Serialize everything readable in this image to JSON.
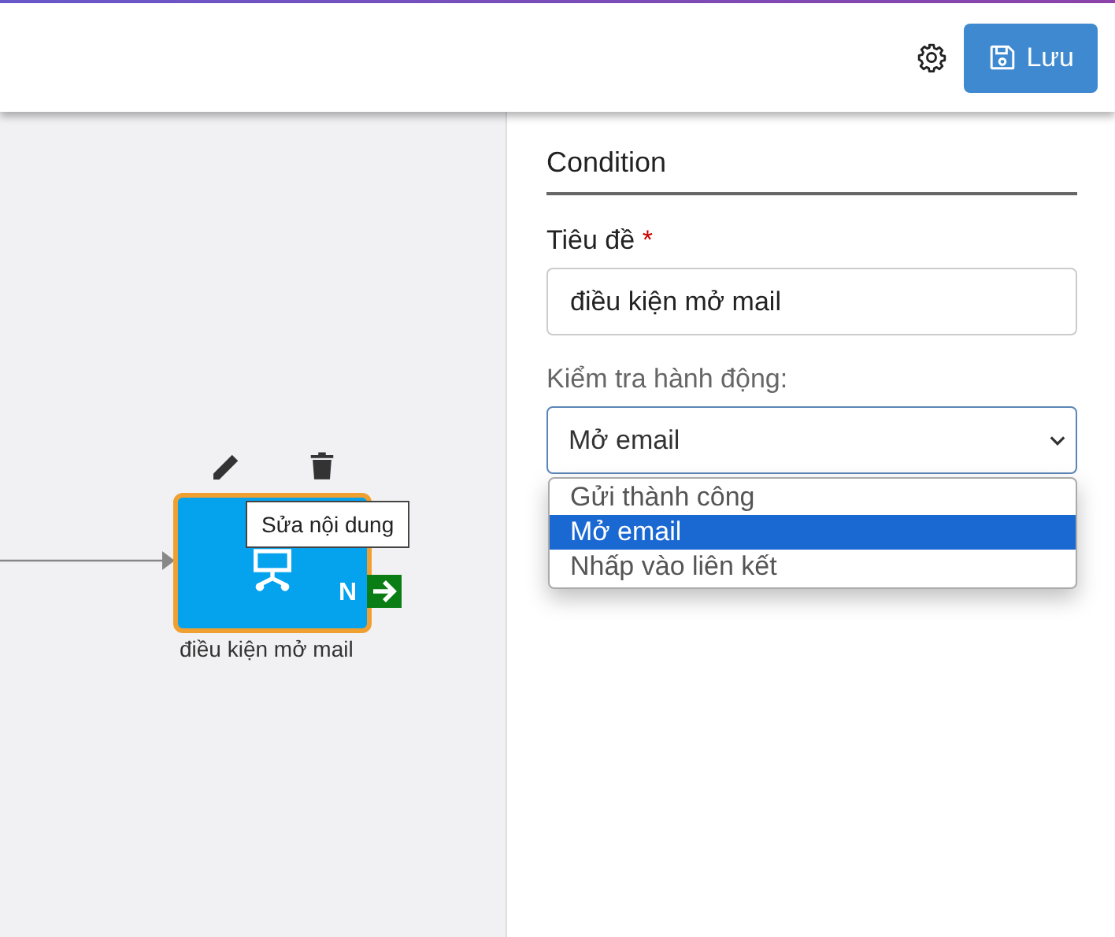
{
  "toolbar": {
    "save_button": "Lưu"
  },
  "canvas": {
    "node": {
      "label": "điều kiện mở mail",
      "branch": "N",
      "tooltip": "Sửa nội dung"
    }
  },
  "panel": {
    "title": "Condition",
    "title_field": {
      "label": "Tiêu đề",
      "required_mark": "*",
      "value": "điều kiện mở mail"
    },
    "action_field": {
      "label": "Kiểm tra hành động:",
      "value": "Mở email",
      "expanded": true,
      "options": [
        {
          "label": "Gửi thành công",
          "selected": false
        },
        {
          "label": "Mở email",
          "selected": true
        },
        {
          "label": "Nhấp vào liên kết",
          "selected": false
        }
      ]
    }
  }
}
